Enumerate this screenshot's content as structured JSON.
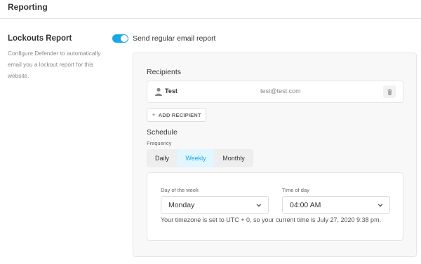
{
  "header": {
    "title": "Reporting"
  },
  "lockouts": {
    "title": "Lockouts Report",
    "description": "Configure Defender to automatically email you a lockout report for this website."
  },
  "toggle": {
    "label": "Send regular email report",
    "enabled": true,
    "accent_color": "#17a8e3"
  },
  "recipients": {
    "label": "Recipients",
    "items": [
      {
        "name": "Test",
        "email": "test@test.com"
      }
    ],
    "add_label": "ADD RECIPIENT",
    "add_icon": "+"
  },
  "schedule": {
    "label": "Schedule",
    "frequency_label": "Frequency",
    "tabs": [
      {
        "label": "Daily",
        "active": false
      },
      {
        "label": "Weekly",
        "active": true
      },
      {
        "label": "Monthly",
        "active": false
      }
    ],
    "day_label": "Day of the week",
    "day_value": "Monday",
    "time_label": "Time of day",
    "time_value": "04:00 AM",
    "timezone_text": "Your timezone is set to UTC + 0, so your current time is July 27, 2020 9:38 pm."
  },
  "icons": {
    "user": "user-icon",
    "trash": "trash-icon",
    "plus": "plus-icon",
    "chevron": "chevron-down-icon"
  }
}
